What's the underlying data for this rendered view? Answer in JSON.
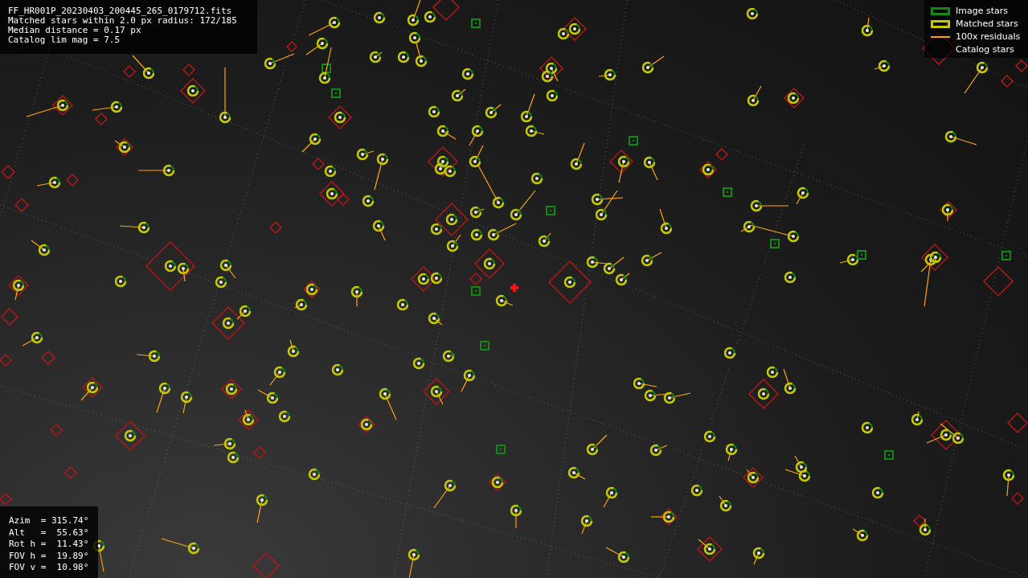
{
  "header": {
    "lines": [
      "FF_HR001P_20230403_200445_265_0179712.fits",
      "Matched stars within 2.0 px radius: 172/185",
      "Median distance = 0.17 px",
      "Catalog lim mag = 7.5"
    ]
  },
  "legend": [
    {
      "kind": "image",
      "label": "Image stars"
    },
    {
      "kind": "matched",
      "label": "Matched stars"
    },
    {
      "kind": "residual",
      "label": "100x residuals"
    },
    {
      "kind": "catalog",
      "label": "Catalog stars"
    }
  ],
  "pointing": {
    "lines": [
      "Azim  = 315.74°",
      "Alt   =  55.63°",
      "Rot h =  11.43°",
      "FOV h =  19.89°",
      "FOV v =  10.98°"
    ]
  }
}
